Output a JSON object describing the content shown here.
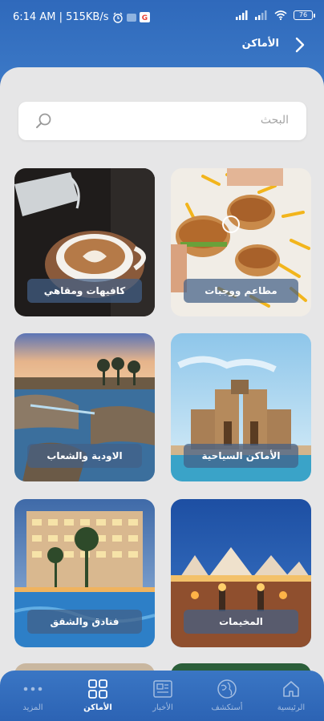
{
  "status_bar": {
    "time_speed": "6:14 AM | 515KB/s",
    "battery": "76"
  },
  "header": {
    "title": "الأماكن"
  },
  "search": {
    "placeholder": "البحث"
  },
  "categories": [
    {
      "label": "مطاعم ووجبات"
    },
    {
      "label": "كافيهات ومقاهي"
    },
    {
      "label": "الأماكن السياحية"
    },
    {
      "label": "الاودية والشعاب"
    },
    {
      "label": "المخيمات"
    },
    {
      "label": "فنادق والشقق"
    }
  ],
  "tabs": [
    {
      "label": "الرئيسية",
      "icon": "home-icon"
    },
    {
      "label": "أستكشف",
      "icon": "globe-icon"
    },
    {
      "label": "الأخبار",
      "icon": "news-icon"
    },
    {
      "label": "الأماكن",
      "icon": "grid-icon",
      "active": true
    },
    {
      "label": "المزيد",
      "icon": "more-icon"
    }
  ],
  "colors": {
    "primary": "#2f66b7",
    "sheet": "#e6e6e7",
    "label_bg": "#426087"
  }
}
